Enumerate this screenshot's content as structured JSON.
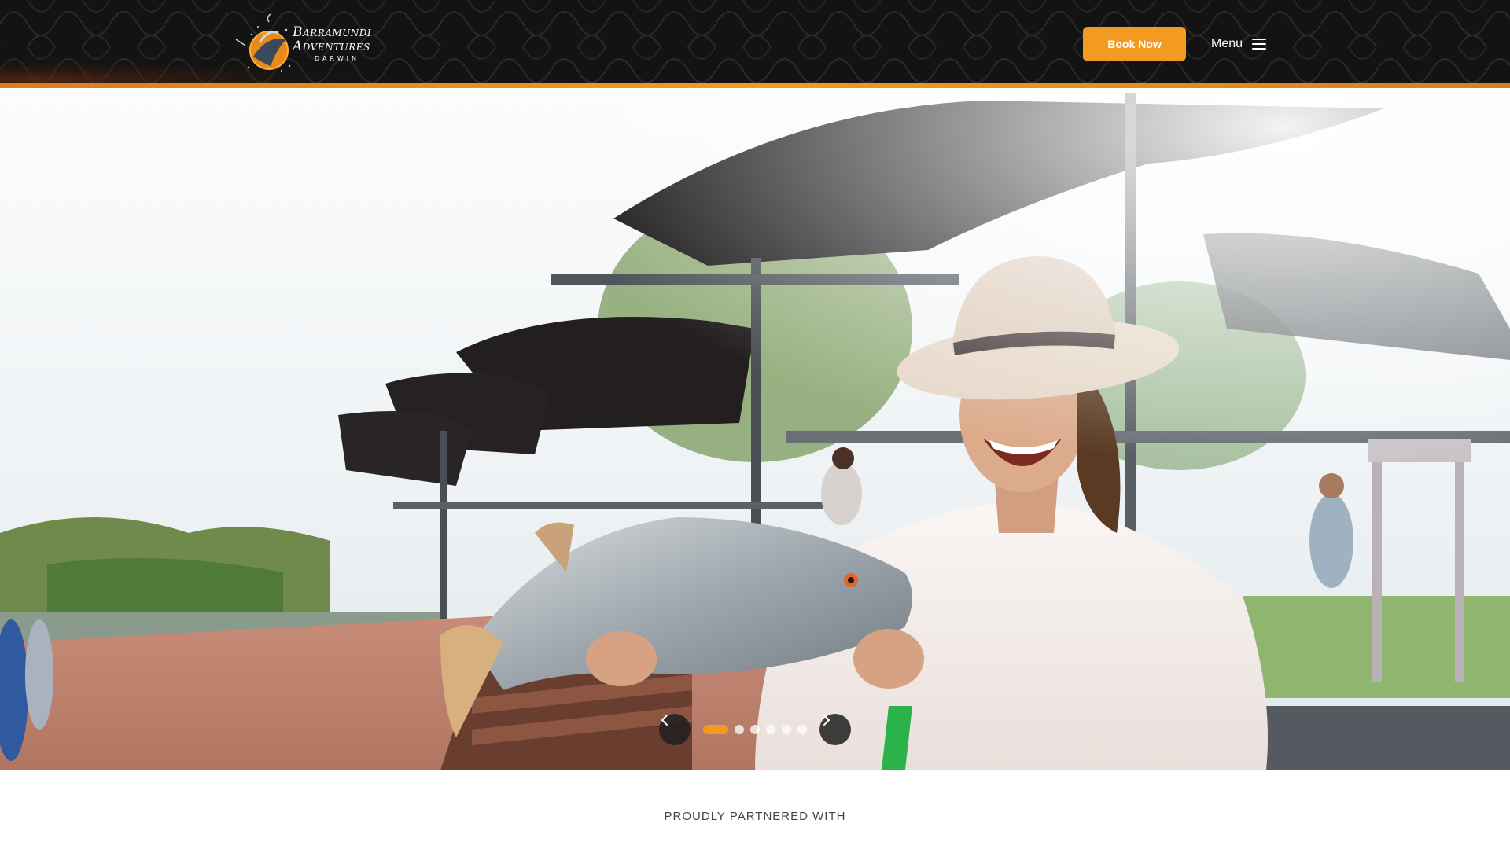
{
  "header": {
    "logo": {
      "line1": "Barramundi",
      "line2": "Adventures",
      "line3": "DARWIN",
      "alt": "Barramundi Adventures Darwin"
    },
    "book_now_label": "Book Now",
    "menu_label": "Menu",
    "icons": {
      "menu": "hamburger-icon"
    }
  },
  "hero": {
    "image_alt": "Woman in a wide-brimmed hat laughing while holding a large barramundi fish on a waterfront deck",
    "slider": {
      "prev_icon": "chevron-left-icon",
      "next_icon": "chevron-right-icon",
      "slide_count": 7,
      "active_index": 0
    }
  },
  "partners": {
    "heading": "PROUDLY PARTNERED WITH"
  },
  "colors": {
    "header_bg": "#131313",
    "accent": "#f39a21",
    "white": "#ffffff"
  }
}
